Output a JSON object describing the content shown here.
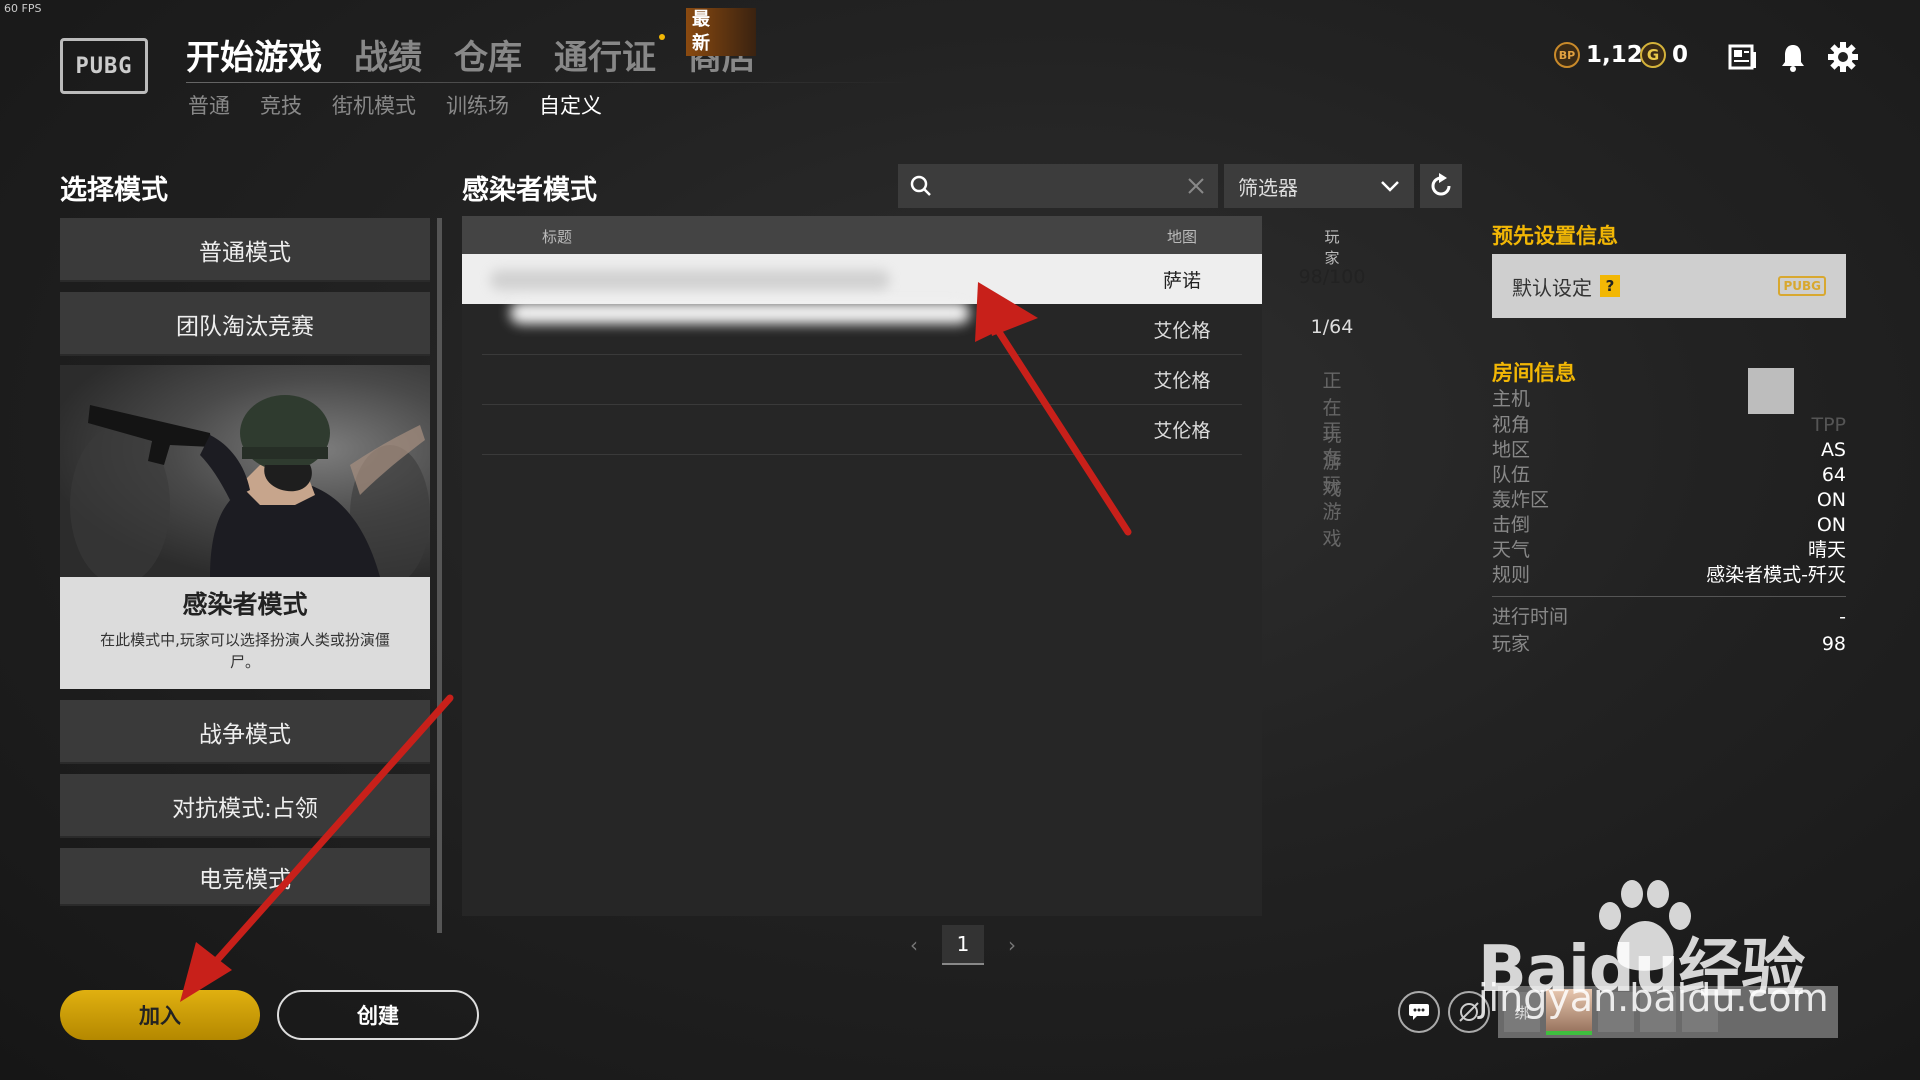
{
  "fps": "60 FPS",
  "logo": "PUBG",
  "main_nav": [
    {
      "label": "开始游戏",
      "active": true
    },
    {
      "label": "战绩",
      "active": false
    },
    {
      "label": "仓库",
      "active": false
    },
    {
      "label": "通行证",
      "active": false
    },
    {
      "label": "商店",
      "active": false
    }
  ],
  "new_badge": "最新",
  "sub_nav": [
    {
      "label": "普通",
      "active": false
    },
    {
      "label": "竞技",
      "active": false
    },
    {
      "label": "街机模式",
      "active": false
    },
    {
      "label": "训练场",
      "active": false
    },
    {
      "label": "自定义",
      "active": true
    }
  ],
  "currency": {
    "bp_icon": "BP",
    "bp": "1,123",
    "g_icon": "G",
    "g": "0"
  },
  "icons": [
    "news-icon",
    "bell-icon",
    "gear-icon"
  ],
  "left": {
    "title": "选择模式",
    "modes": [
      "普通模式",
      "团队淘汰竞赛"
    ],
    "featured": {
      "title": "感染者模式",
      "desc": "在此模式中,玩家可以选择扮演人类或扮演僵尸。"
    },
    "modes_after": [
      "战争模式",
      "对抗模式:占领",
      "电竞模式"
    ]
  },
  "list": {
    "title": "感染者模式",
    "filter_label": "筛选器",
    "headers": {
      "title": "标题",
      "map": "地图",
      "players": "玩家"
    },
    "rows": [
      {
        "map": "萨诺",
        "players": "98/100",
        "playing": false,
        "selected": true
      },
      {
        "map": "艾伦格",
        "players": "1/64",
        "playing": false,
        "selected": false
      },
      {
        "map": "艾伦格",
        "players": "正在玩游戏",
        "playing": true,
        "selected": false
      },
      {
        "map": "艾伦格",
        "players": "正在玩游戏",
        "playing": true,
        "selected": false
      }
    ],
    "page": "1"
  },
  "right": {
    "preset_title": "预先设置信息",
    "preset_label": "默认设定",
    "preset_q": "?",
    "preset_logo": "PUBG",
    "room_title": "房间信息",
    "room": [
      {
        "k": "主机",
        "v": ""
      },
      {
        "k": "视角",
        "v": "TPP"
      },
      {
        "k": "地区",
        "v": "AS"
      },
      {
        "k": "队伍",
        "v": "64"
      },
      {
        "k": "轰炸区",
        "v": "ON"
      },
      {
        "k": "击倒",
        "v": "ON"
      },
      {
        "k": "天气",
        "v": "晴天"
      },
      {
        "k": "规则",
        "v": "感染者模式-歼灭"
      }
    ],
    "stats": [
      {
        "k": "进行时间",
        "v": "-"
      },
      {
        "k": "玩家",
        "v": "98"
      }
    ]
  },
  "buttons": {
    "join": "加入",
    "create": "创建"
  },
  "squad_slot": "绑",
  "watermark": {
    "brand": "Baidu经验",
    "url": "jingyan.baidu.com"
  },
  "colors": {
    "accent": "#f2b705",
    "arrow": "#c8201a",
    "join": "#d4a300"
  }
}
